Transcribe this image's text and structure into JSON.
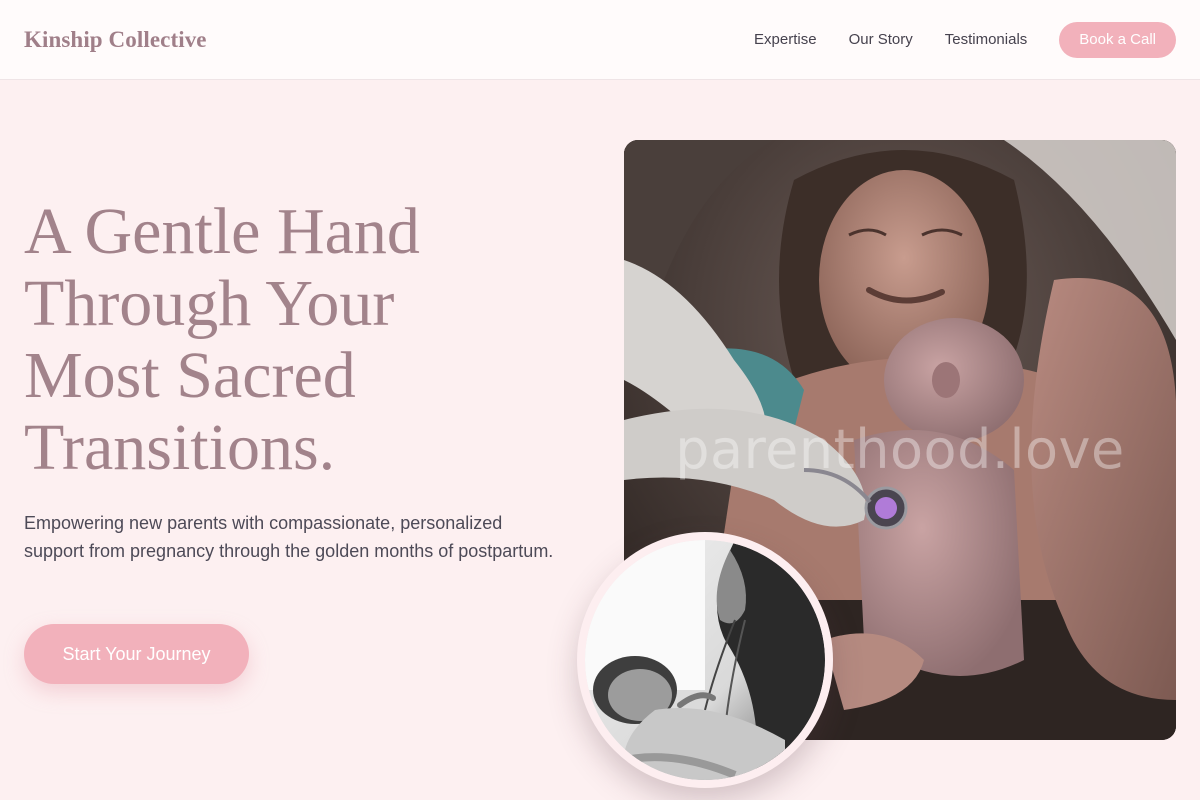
{
  "header": {
    "brand": "Kinship Collective",
    "nav": [
      {
        "label": "Expertise"
      },
      {
        "label": "Our Story"
      },
      {
        "label": "Testimonials"
      }
    ],
    "cta_label": "Book a Call"
  },
  "hero": {
    "title_lines": [
      "A Gentle Hand",
      "Through Your",
      "Most Sacred",
      "Transitions."
    ],
    "subtitle": "Empowering new parents with compassionate, personalized support from pregnancy through the golden months of postpartum.",
    "cta_label": "Start Your Journey"
  },
  "images": {
    "main_photo": {
      "watermark": "parenthood.love"
    }
  },
  "colors": {
    "background": "#fdf0f1",
    "header_bg": "#fffbfb",
    "accent_pink": "#f2b1bb",
    "heading_mauve": "#a2838b",
    "body_text": "#4d4a57"
  }
}
